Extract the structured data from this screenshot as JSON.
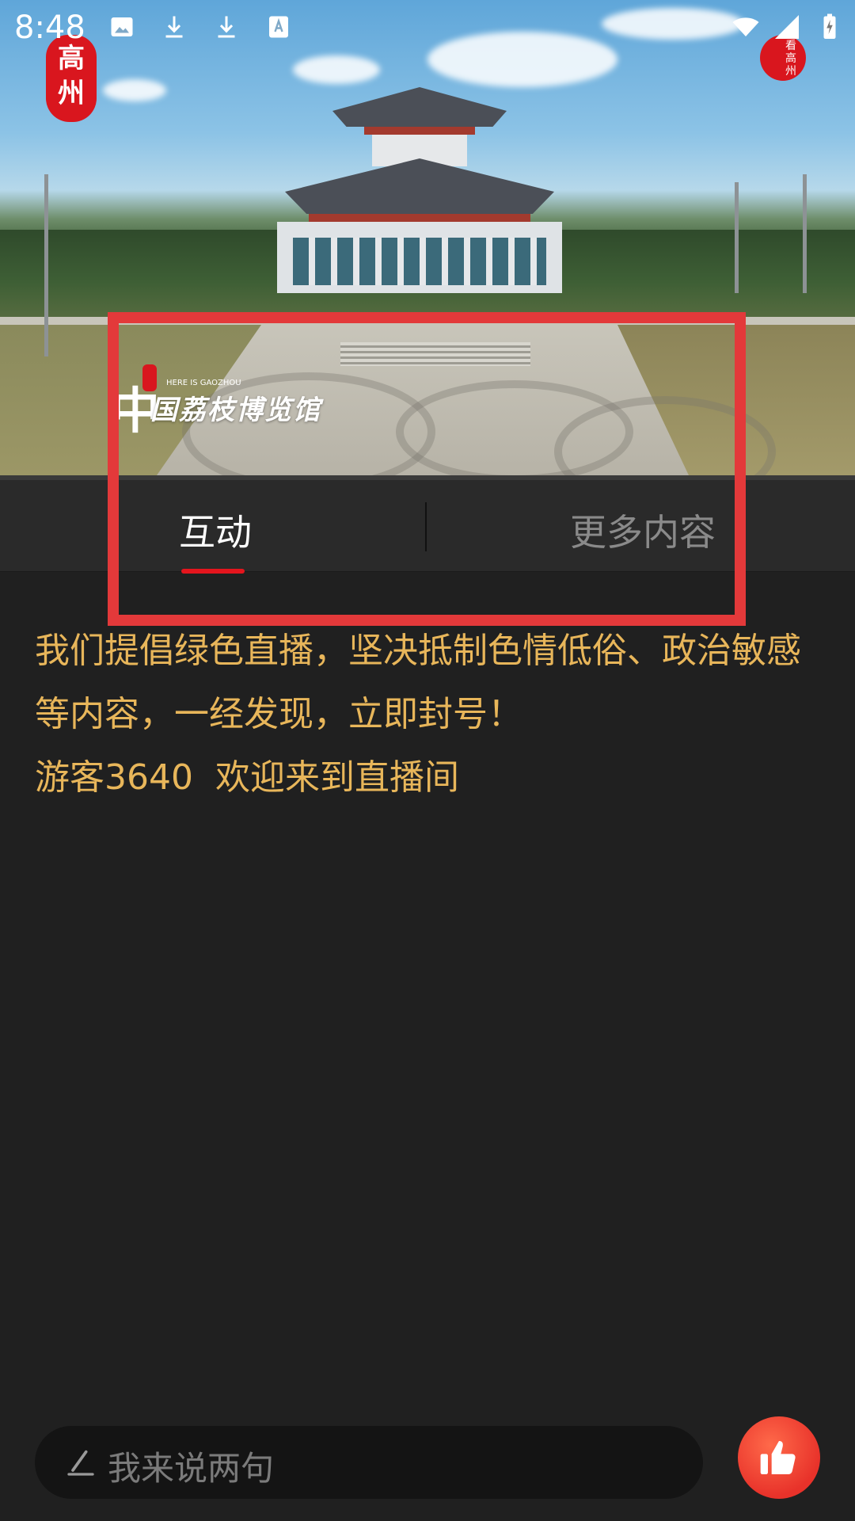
{
  "status_bar": {
    "time": "8:48",
    "icons": [
      "image-icon",
      "download-icon",
      "download-icon",
      "text-icon",
      "wifi-icon",
      "signal-icon",
      "battery-icon"
    ]
  },
  "logos": {
    "top_left": "高\n州",
    "top_right": "看\n高\n州",
    "museum_title": "国荔枝博览馆",
    "museum_zhong": "中",
    "museum_sub": "HERE IS GAOZHOU",
    "museum_seal": "高\n州"
  },
  "tabs": {
    "active": "互动",
    "more": "更多内容"
  },
  "chat": {
    "notice": "我们提倡绿色直播，坚决抵制色情低俗、政治敏感等内容，一经发现，立即封号！",
    "welcome": "游客3640  欢迎来到直播间"
  },
  "input": {
    "placeholder": "我来说两句"
  },
  "colors": {
    "accent": "#e4151d",
    "chat_text": "#e8b65a",
    "highlight": "#e3393a"
  }
}
